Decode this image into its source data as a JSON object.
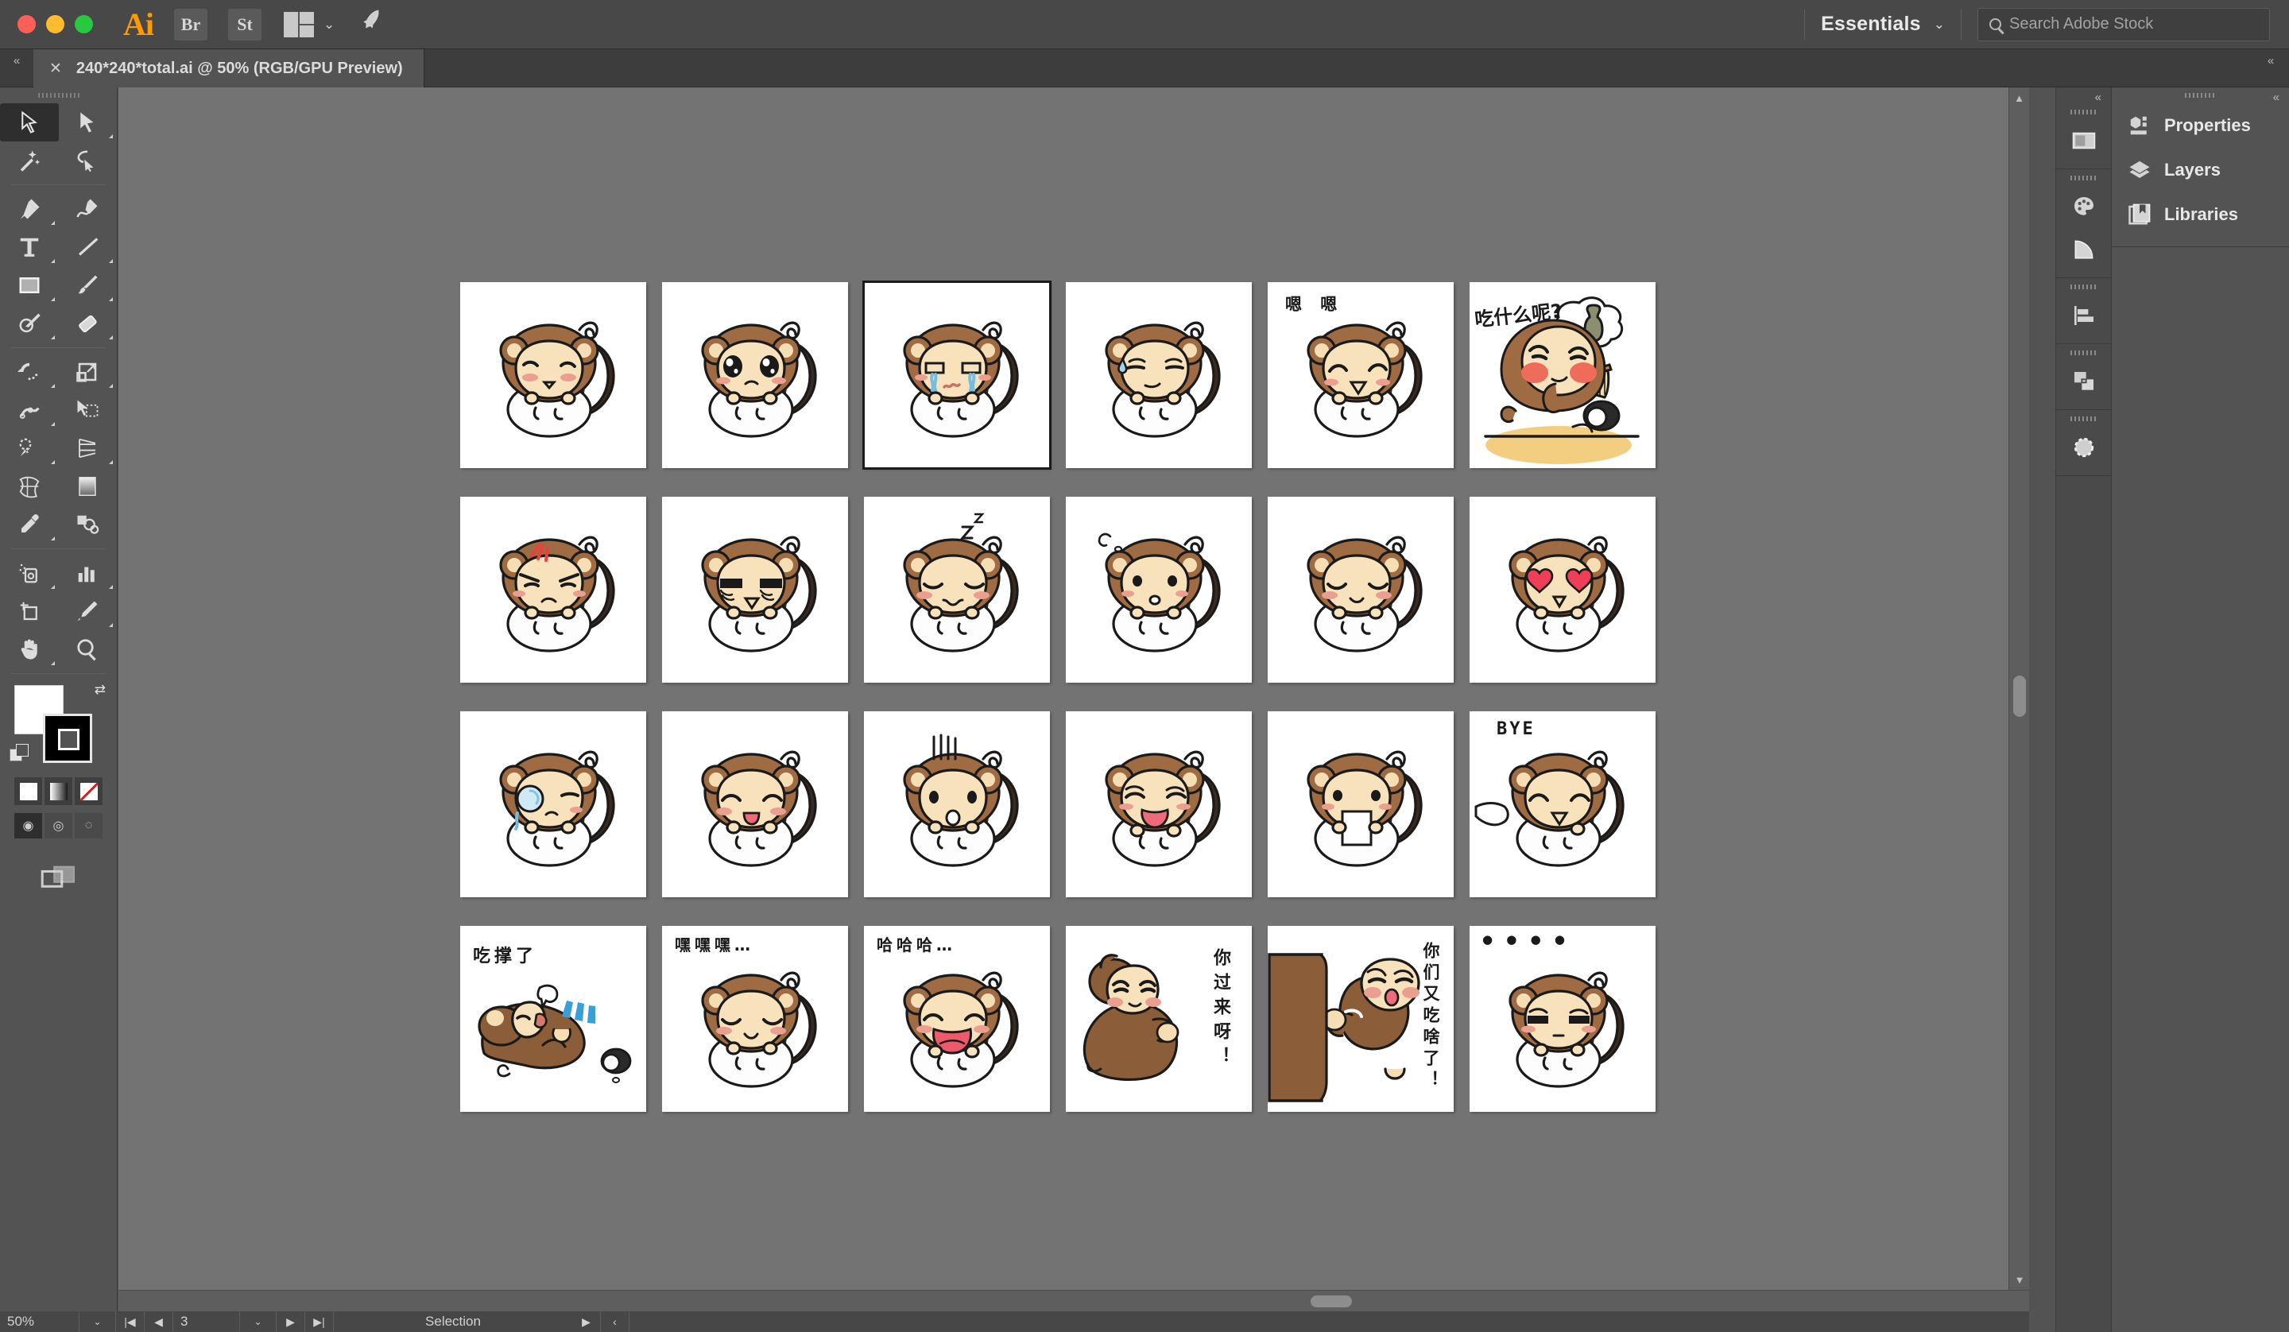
{
  "window": {
    "traffic_lights": [
      "close",
      "minimize",
      "maximize"
    ],
    "app_logo": "Ai",
    "bridge_label": "Br",
    "stock_label": "St",
    "arrange_icon": "arrange-documents-icon",
    "chevron": "⌄",
    "rocket_icon": "discover-icon"
  },
  "toolbar_top": {
    "workspace": "Essentials",
    "workspace_chevron": "⌄",
    "search_placeholder": "Search Adobe Stock"
  },
  "tabs": {
    "collapse_left": "«",
    "collapse_right": "«",
    "close_glyph": "✕",
    "documents": [
      {
        "title": "240*240*total.ai @ 50% (RGB/GPU Preview)",
        "active": true
      }
    ]
  },
  "tools": [
    {
      "name": "selection-tool",
      "selected": true,
      "corner": false
    },
    {
      "name": "direct-selection-tool",
      "selected": false,
      "corner": true
    },
    {
      "name": "magic-wand-tool",
      "selected": false,
      "corner": false
    },
    {
      "name": "lasso-tool",
      "selected": false,
      "corner": false
    },
    {
      "name": "pen-tool",
      "selected": false,
      "corner": true
    },
    {
      "name": "curvature-tool",
      "selected": false,
      "corner": false
    },
    {
      "name": "type-tool",
      "selected": false,
      "corner": true
    },
    {
      "name": "line-segment-tool",
      "selected": false,
      "corner": true
    },
    {
      "name": "rectangle-tool",
      "selected": false,
      "corner": true
    },
    {
      "name": "paintbrush-tool",
      "selected": false,
      "corner": true
    },
    {
      "name": "shaper-tool",
      "selected": false,
      "corner": true
    },
    {
      "name": "eraser-tool",
      "selected": false,
      "corner": true
    },
    {
      "name": "rotate-tool",
      "selected": false,
      "corner": true
    },
    {
      "name": "scale-tool",
      "selected": false,
      "corner": true
    },
    {
      "name": "width-tool",
      "selected": false,
      "corner": true
    },
    {
      "name": "free-transform-tool",
      "selected": false,
      "corner": false
    },
    {
      "name": "shape-builder-tool",
      "selected": false,
      "corner": true
    },
    {
      "name": "perspective-grid-tool",
      "selected": false,
      "corner": true
    },
    {
      "name": "mesh-tool",
      "selected": false,
      "corner": false
    },
    {
      "name": "gradient-tool",
      "selected": false,
      "corner": false
    },
    {
      "name": "eyedropper-tool",
      "selected": false,
      "corner": true
    },
    {
      "name": "blend-tool",
      "selected": false,
      "corner": false
    },
    {
      "name": "symbol-sprayer-tool",
      "selected": false,
      "corner": true
    },
    {
      "name": "column-graph-tool",
      "selected": false,
      "corner": true
    },
    {
      "name": "artboard-tool",
      "selected": false,
      "corner": false
    },
    {
      "name": "slice-tool",
      "selected": false,
      "corner": true
    },
    {
      "name": "hand-tool",
      "selected": false,
      "corner": true
    },
    {
      "name": "zoom-tool",
      "selected": false,
      "corner": false
    }
  ],
  "color_controls": {
    "fill_color": "#ffffff",
    "stroke_color": "#000000",
    "swap_icon": "swap-fill-stroke-icon",
    "default_icon": "default-fill-stroke-icon",
    "modes": [
      {
        "name": "color-mode",
        "active": true
      },
      {
        "name": "gradient-mode",
        "active": false
      },
      {
        "name": "none-mode",
        "active": false
      }
    ],
    "draw_modes": [
      {
        "name": "draw-normal",
        "active": true
      },
      {
        "name": "draw-behind",
        "active": false
      },
      {
        "name": "draw-inside",
        "active": false
      }
    ],
    "screen_mode": "change-screen-mode-icon"
  },
  "status_bar": {
    "zoom": "50%",
    "zoom_dropdown": "⌄",
    "first_page": "|◀",
    "prev_page": "◀",
    "page": "3",
    "page_dropdown": "⌄",
    "next_page": "▶",
    "last_page": "▶|",
    "status_text": "Selection",
    "status_menu": "▶",
    "resize_handle": "‹"
  },
  "dock": {
    "collapse": "«",
    "icon_groups": [
      {
        "icons": [
          "artboards-panel-icon"
        ]
      },
      {
        "icons": [
          "color-panel-icon",
          "color-guide-panel-icon"
        ]
      },
      {
        "icons": [
          "align-panel-icon"
        ]
      },
      {
        "icons": [
          "transform-panel-icon"
        ]
      },
      {
        "icons": [
          "transparency-panel-icon"
        ]
      }
    ],
    "panels": [
      {
        "label": "Properties",
        "icon": "properties-panel-icon"
      },
      {
        "label": "Layers",
        "icon": "layers-panel-icon"
      },
      {
        "label": "Libraries",
        "icon": "libraries-panel-icon"
      }
    ]
  },
  "canvas": {
    "background": "#737373",
    "artboard_bg": "#ffffff",
    "selected_index": 2,
    "artboards": [
      {
        "id": 1,
        "expression": "wincing-face",
        "caption": ""
      },
      {
        "id": 2,
        "expression": "teary-big-eyes",
        "caption": ""
      },
      {
        "id": 3,
        "expression": "crying",
        "caption": ""
      },
      {
        "id": 4,
        "expression": "sweat-drop",
        "caption": ""
      },
      {
        "id": 5,
        "expression": "laughing",
        "caption": "嗯 嗯"
      },
      {
        "id": 6,
        "expression": "thinking-food",
        "caption": "吃什么呢?"
      },
      {
        "id": 7,
        "expression": "angry-vein",
        "caption": ""
      },
      {
        "id": 8,
        "expression": "tired-eyebags",
        "caption": ""
      },
      {
        "id": 9,
        "expression": "sleeping",
        "caption": "Z z"
      },
      {
        "id": 10,
        "expression": "whistling",
        "caption": ""
      },
      {
        "id": 11,
        "expression": "content-smile",
        "caption": ""
      },
      {
        "id": 12,
        "expression": "heart-eyes",
        "caption": ""
      },
      {
        "id": 13,
        "expression": "crying-monocle",
        "caption": ""
      },
      {
        "id": 14,
        "expression": "tongue-out",
        "caption": ""
      },
      {
        "id": 15,
        "expression": "shocked-lines",
        "caption": ""
      },
      {
        "id": 16,
        "expression": "drooling-tongue",
        "caption": ""
      },
      {
        "id": 17,
        "expression": "holding-sign",
        "caption": ""
      },
      {
        "id": 18,
        "expression": "waving-bye",
        "caption": "BYE"
      },
      {
        "id": 19,
        "expression": "lying-full",
        "caption": "吃撑了"
      },
      {
        "id": 20,
        "expression": "giggling",
        "caption": "嘿嘿嘿…"
      },
      {
        "id": 21,
        "expression": "laughing-wide",
        "caption": "哈哈哈…"
      },
      {
        "id": 22,
        "expression": "beckoning",
        "caption": "你过来呀！"
      },
      {
        "id": 23,
        "expression": "peeking-door",
        "caption": "你们又吃啥了！"
      },
      {
        "id": 24,
        "expression": "unamused-dots",
        "caption": "● ● ● ●"
      }
    ]
  }
}
